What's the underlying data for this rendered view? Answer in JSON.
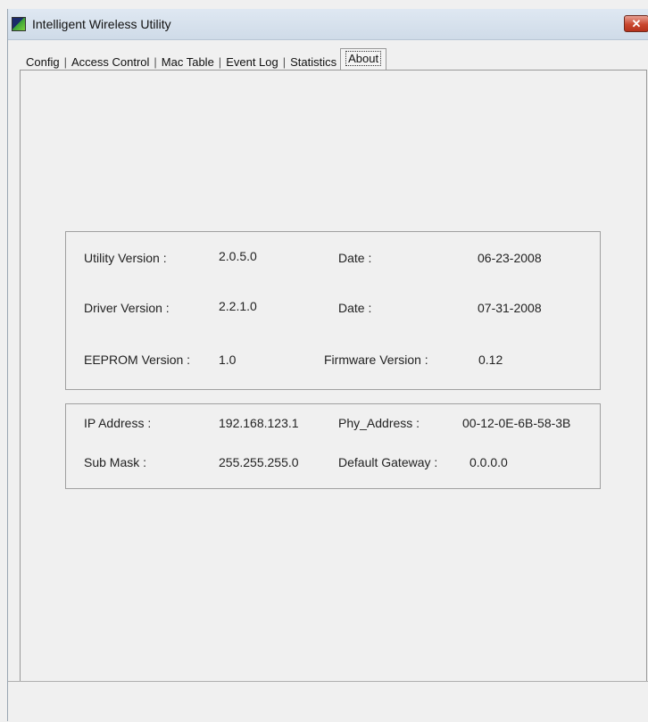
{
  "window": {
    "title": "Intelligent Wireless Utility",
    "close_glyph": "✕",
    "accent": "#c9472e"
  },
  "tabs": [
    {
      "label": "Config"
    },
    {
      "label": "Access Control"
    },
    {
      "label": "Mac Table"
    },
    {
      "label": "Event Log"
    },
    {
      "label": "Statistics"
    },
    {
      "label": "About",
      "active": true
    }
  ],
  "versions": {
    "utility_label": "Utility Version :",
    "utility_value": "2.0.5.0",
    "utility_date_label": "Date :",
    "utility_date": "06-23-2008",
    "driver_label": "Driver Version :",
    "driver_value": "2.2.1.0",
    "driver_date_label": "Date :",
    "driver_date": "07-31-2008",
    "eeprom_label": "EEPROM Version :",
    "eeprom_value": "1.0",
    "firmware_label": "Firmware Version :",
    "firmware_value": "0.12"
  },
  "network": {
    "ip_label": "IP Address :",
    "ip_value": "192.168.123.1",
    "phy_label": "Phy_Address :",
    "phy_value": "00-12-0E-6B-58-3B",
    "mask_label": "Sub Mask :",
    "mask_value": "255.255.255.0",
    "gateway_label": "Default Gateway :",
    "gateway_value": "0.0.0.0"
  },
  "icons": {
    "app": "app-icon",
    "close": "close-icon"
  }
}
